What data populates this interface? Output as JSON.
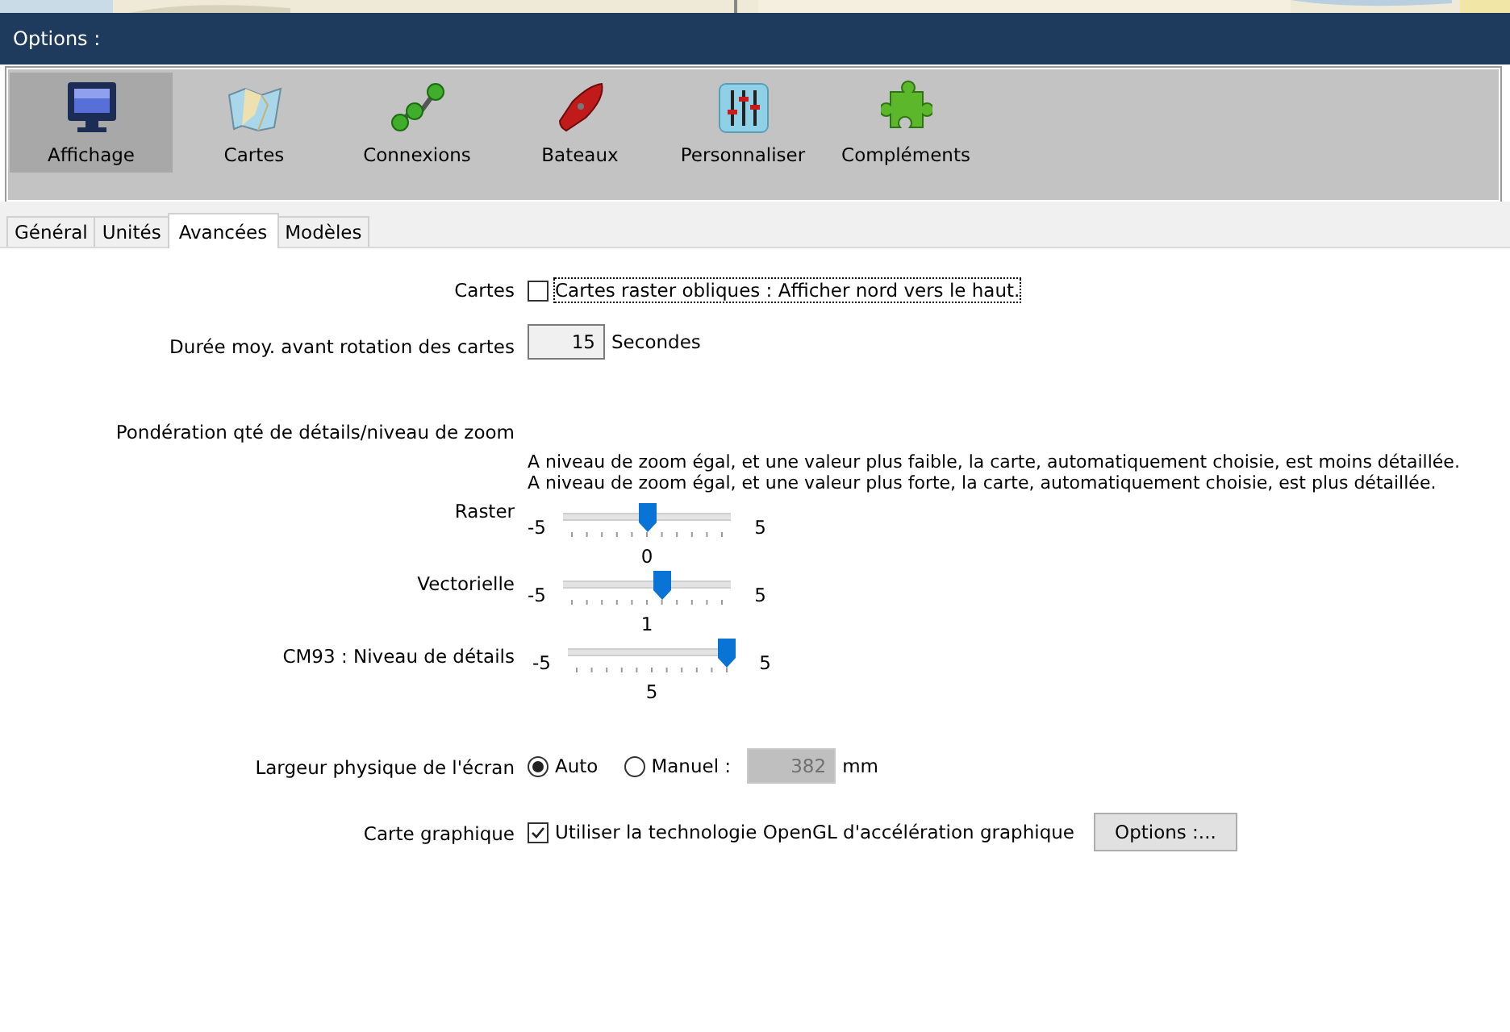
{
  "window": {
    "title": "Options :"
  },
  "categories": [
    {
      "label": "Affichage",
      "selected": true
    },
    {
      "label": "Cartes",
      "selected": false
    },
    {
      "label": "Connexions",
      "selected": false
    },
    {
      "label": "Bateaux",
      "selected": false
    },
    {
      "label": "Personnaliser",
      "selected": false
    },
    {
      "label": "Compléments",
      "selected": false
    }
  ],
  "tabs": [
    {
      "label": "Général",
      "selected": false
    },
    {
      "label": "Unités",
      "selected": false
    },
    {
      "label": "Avancées",
      "selected": true
    },
    {
      "label": "Modèles",
      "selected": false
    }
  ],
  "settings": {
    "charts": {
      "label": "Cartes",
      "checkbox_label": "Cartes raster obliques : Afficher nord vers le haut.",
      "checked": false
    },
    "rotation": {
      "label": "Durée moy. avant rotation des cartes",
      "value": "15",
      "unit": "Secondes"
    },
    "detail": {
      "label": "Pondération qté de détails/niveau de zoom",
      "notes": [
        "A niveau de zoom égal, et une valeur plus faible, la carte, automatiquement choisie, est moins détaillée.",
        "A niveau de zoom égal, et une valeur plus forte, la carte, automatiquement choisie, est plus détaillée."
      ],
      "sliders": [
        {
          "label": "Raster",
          "min": "-5",
          "max": "5",
          "value": "0",
          "level": 0.5
        },
        {
          "label": "Vectorielle",
          "min": "-5",
          "max": "5",
          "value": "1",
          "level": 0.6
        },
        {
          "label": "CM93 : Niveau de détails",
          "min": "-5",
          "max": "5",
          "value": "5",
          "level": 1
        }
      ]
    },
    "screen_width": {
      "label": "Largeur physique de l'écran",
      "options": [
        {
          "label": "Auto",
          "selected": true
        },
        {
          "label": "Manuel :",
          "selected": false
        }
      ],
      "value": "382",
      "unit": "mm"
    },
    "graphics": {
      "label": "Carte graphique",
      "checkbox_label": "Utiliser la technologie OpenGL d'accélération graphique",
      "checked": true,
      "button": "Options :..."
    }
  }
}
